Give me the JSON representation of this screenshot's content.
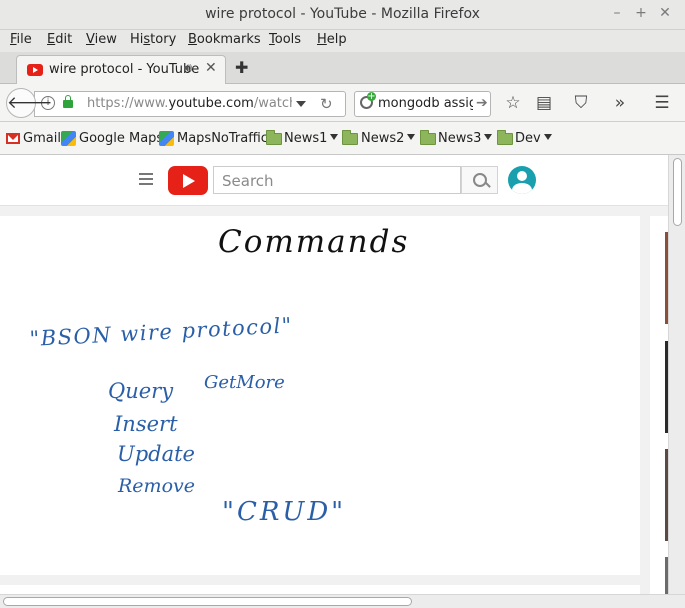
{
  "window": {
    "title": "wire protocol - YouTube - Mozilla Firefox"
  },
  "menubar": {
    "items": [
      {
        "key": "F",
        "rest": "ile"
      },
      {
        "key": "E",
        "rest": "dit"
      },
      {
        "key": "V",
        "rest": "iew"
      },
      {
        "key": "",
        "pre": "Hi",
        "key2": "s",
        "rest": "tory"
      },
      {
        "key": "B",
        "rest": "ookmarks"
      },
      {
        "key": "T",
        "rest": "ools"
      },
      {
        "key": "H",
        "rest": "elp"
      }
    ]
  },
  "tabs": [
    {
      "label": "wire protocol - YouTube",
      "active": true
    }
  ],
  "navbar": {
    "url_prefix": "https://www.",
    "url_domain": "youtube.com",
    "url_path": "/watch?v=L",
    "search_value": "mongodb assign"
  },
  "bookmarks": [
    {
      "label": "Gmail",
      "icon": "gmail-icon"
    },
    {
      "label": "Google Maps",
      "icon": "maps-icon"
    },
    {
      "label": "MapsNoTraffic",
      "icon": "maps-icon"
    },
    {
      "label": "News1",
      "icon": "folder-icon"
    },
    {
      "label": "News2",
      "icon": "folder-icon"
    },
    {
      "label": "News3",
      "icon": "folder-icon"
    },
    {
      "label": "Dev",
      "icon": "folder-icon"
    }
  ],
  "youtube": {
    "search_placeholder": "Search",
    "video": {
      "title": "Commands",
      "quote": "\"BSON wire protocol\"",
      "ops_left": [
        "Query",
        "Insert",
        "Update",
        "Remove"
      ],
      "ops_right": "GetMore",
      "crud": "\"CRUD\""
    }
  },
  "colors": {
    "youtube_red": "#e62117",
    "ink_blue": "#2a5fa8",
    "ink_black": "#111111"
  }
}
